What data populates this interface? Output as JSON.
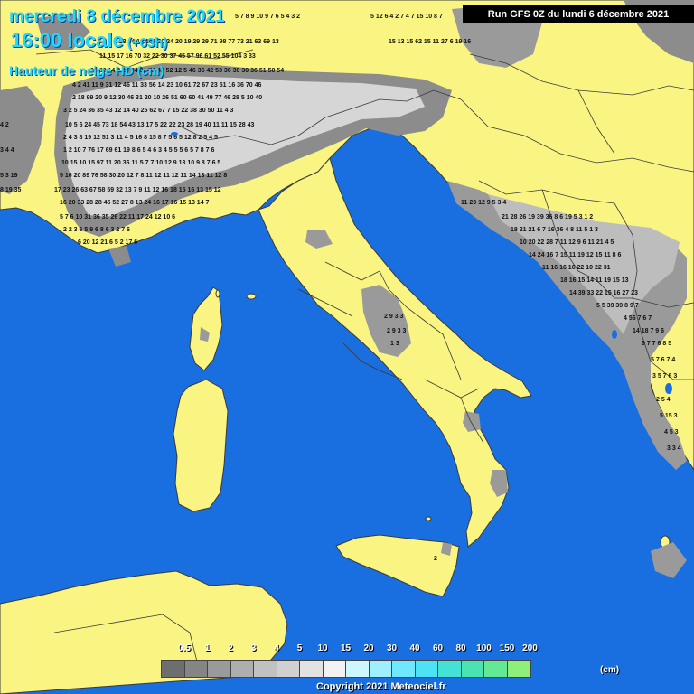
{
  "title": {
    "date": "mercredi 8 décembre 2021",
    "time": "16:00 locale",
    "lead": "(+63h)",
    "parameter": "Hauteur de neige HD (cm)"
  },
  "run": "Run GFS 0Z du lundi 6 décembre 2021",
  "legend": {
    "labels": [
      "0.5",
      "1",
      "2",
      "3",
      "4",
      "5",
      "10",
      "15",
      "20",
      "30",
      "40",
      "60",
      "80",
      "100",
      "150",
      "200"
    ],
    "colors": [
      "#6e6e6e",
      "#858585",
      "#9a9a9a",
      "#aeaeae",
      "#c1c1c1",
      "#d0d0d0",
      "#e2e2e2",
      "#f2f2f2",
      "#ccf7ff",
      "#9ff0ff",
      "#70e8ff",
      "#4de2f5",
      "#43e2d5",
      "#4ae4b3",
      "#63e893",
      "#8ef07a"
    ],
    "unit": "(cm)"
  },
  "copyright": "Copyright 2021 Meteociel.fr",
  "colors": {
    "sea": "#1a6fe0",
    "land": "#faf582",
    "border": "#3a3a3a",
    "title": "#1fd7ff"
  }
}
